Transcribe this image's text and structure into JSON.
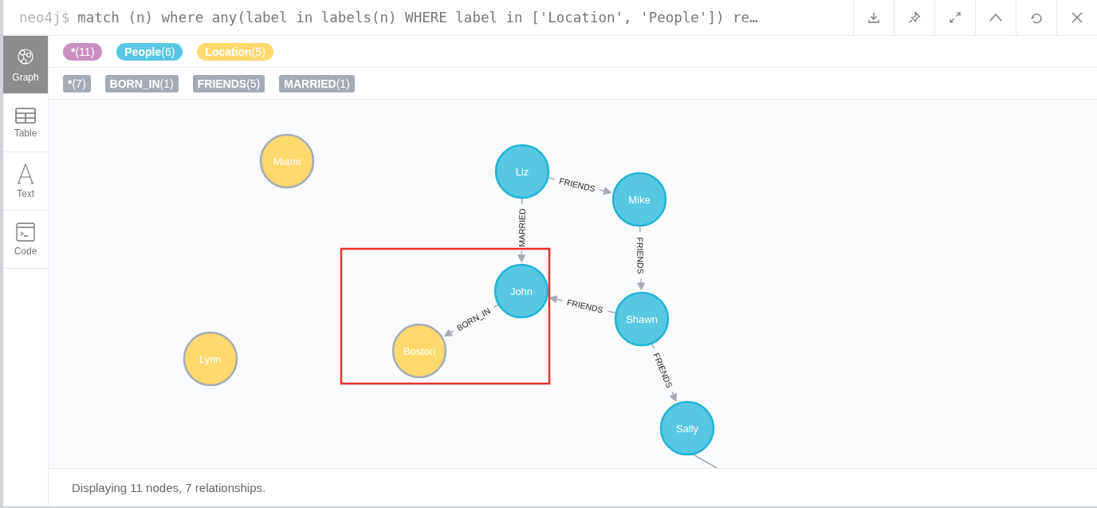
{
  "editor": {
    "prompt": "neo4j$",
    "query": "match (n) where any(label in labels(n) WHERE label in ['Location', 'People']) re…"
  },
  "toolbar": [
    {
      "kind": "download"
    },
    {
      "kind": "pin"
    },
    {
      "kind": "expand"
    },
    {
      "kind": "collapse"
    },
    {
      "kind": "rerun"
    },
    {
      "kind": "close"
    }
  ],
  "sidebar": {
    "items": [
      {
        "label": "Graph",
        "kind": "graph",
        "selected": true
      },
      {
        "label": "Table",
        "kind": "table",
        "selected": false
      },
      {
        "label": "Text",
        "kind": "text",
        "selected": false
      },
      {
        "label": "Code",
        "kind": "code",
        "selected": false
      }
    ]
  },
  "node_labels": [
    {
      "name": "*",
      "count": "(11)",
      "color": "#c990c0"
    },
    {
      "name": "People",
      "count": "(6)",
      "color": "#57c7e3"
    },
    {
      "name": "Location",
      "count": "(5)",
      "color": "#ffd86e"
    }
  ],
  "relationship_types": [
    {
      "name": "*",
      "count": "(7)"
    },
    {
      "name": "BORN_IN",
      "count": "(1)"
    },
    {
      "name": "FRIENDS",
      "count": "(5)"
    },
    {
      "name": "MARRIED",
      "count": "(1)"
    }
  ],
  "graph": {
    "nodes": [
      {
        "caption": "Miami",
        "kind": "location"
      },
      {
        "caption": "Liz",
        "kind": "people"
      },
      {
        "caption": "Mike",
        "kind": "people"
      },
      {
        "caption": "John",
        "kind": "people"
      },
      {
        "caption": "Shawn",
        "kind": "people"
      },
      {
        "caption": "Boston",
        "kind": "location"
      },
      {
        "caption": "Lynn",
        "kind": "location"
      },
      {
        "caption": "Sally",
        "kind": "people"
      }
    ],
    "relationships": [
      {
        "type": "FRIENDS"
      },
      {
        "type": "MARRIED"
      },
      {
        "type": "FRIENDS"
      },
      {
        "type": "FRIENDS"
      },
      {
        "type": "BORN_IN"
      },
      {
        "type": "FRIENDS"
      }
    ]
  },
  "status": "Displaying 11 nodes, 7 relationships."
}
